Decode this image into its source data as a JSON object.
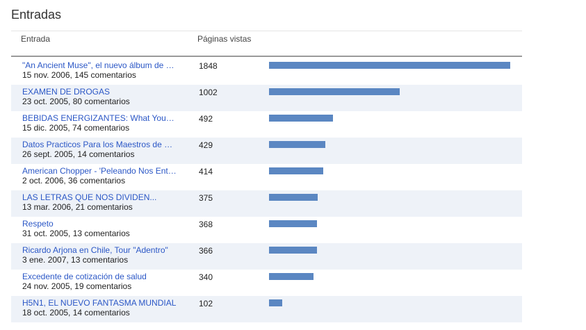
{
  "page": {
    "title": "Entradas"
  },
  "table": {
    "columns": {
      "entry": "Entrada",
      "views": "Páginas vistas"
    },
    "bar_color": "#5b87c2",
    "link_color": "#2b57c6",
    "alt_row_color": "#eef2f8",
    "rows": [
      {
        "title": "\"An Ancient Muse\", el nuevo álbum de Loreena McKennitt",
        "meta": "15 nov. 2006, 145 comentarios",
        "views": 1848
      },
      {
        "title": "EXAMEN DE DROGAS",
        "meta": "23 oct. 2005, 80 comentarios",
        "views": 1002
      },
      {
        "title": "BEBIDAS ENERGIZANTES: What You Need to Know",
        "meta": "15 dic. 2005, 74 comentarios",
        "views": 492
      },
      {
        "title": "Datos Practicos Para los Maestros de Escuela",
        "meta": "26 sept. 2005, 14 comentarios",
        "views": 429
      },
      {
        "title": "American Chopper - 'Peleando Nos Entendemos'",
        "meta": "2 oct. 2006, 36 comentarios",
        "views": 414
      },
      {
        "title": "LAS LETRAS QUE NOS DIVIDEN...",
        "meta": "13 mar. 2006, 21 comentarios",
        "views": 375
      },
      {
        "title": "Respeto",
        "meta": "31 oct. 2005, 13 comentarios",
        "views": 368
      },
      {
        "title": "Ricardo Arjona en Chile, Tour \"Adentro\"",
        "meta": "3 ene. 2007, 13 comentarios",
        "views": 366
      },
      {
        "title": "Excedente de cotización de salud",
        "meta": "24 nov. 2005, 19 comentarios",
        "views": 340
      },
      {
        "title": "H5N1, EL NUEVO FANTASMA MUNDIAL",
        "meta": "18 oct. 2005, 14 comentarios",
        "views": 102
      }
    ]
  }
}
